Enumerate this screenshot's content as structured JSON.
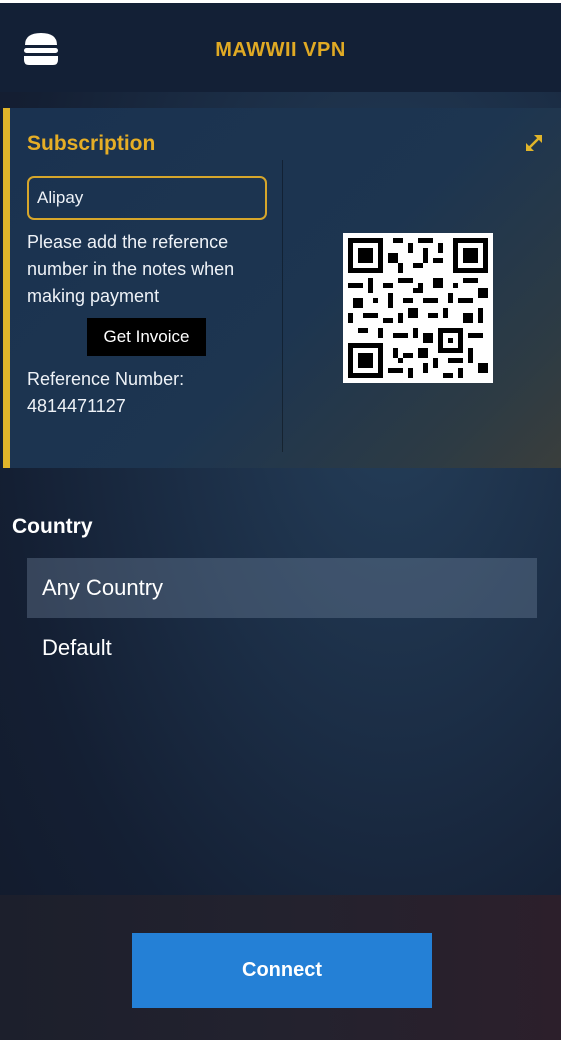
{
  "header": {
    "title": "MAWWII VPN",
    "menu_icon": "hamburger-menu-icon"
  },
  "subscription": {
    "title": "Subscription",
    "expand_icon": "expand-arrows-icon",
    "payment_method": "Alipay",
    "instructions": "Please add the reference number in the notes when making payment",
    "invoice_button": "Get Invoice",
    "reference_label": "Reference Number:",
    "reference_number": "4814471127",
    "qr_icon": "qr-code"
  },
  "country": {
    "heading": "Country",
    "items": [
      {
        "label": "Any Country",
        "selected": true
      },
      {
        "label": "Default",
        "selected": false
      }
    ]
  },
  "footer": {
    "connect_label": "Connect"
  },
  "colors": {
    "accent": "#e0aa24",
    "connect": "#2480d6"
  }
}
